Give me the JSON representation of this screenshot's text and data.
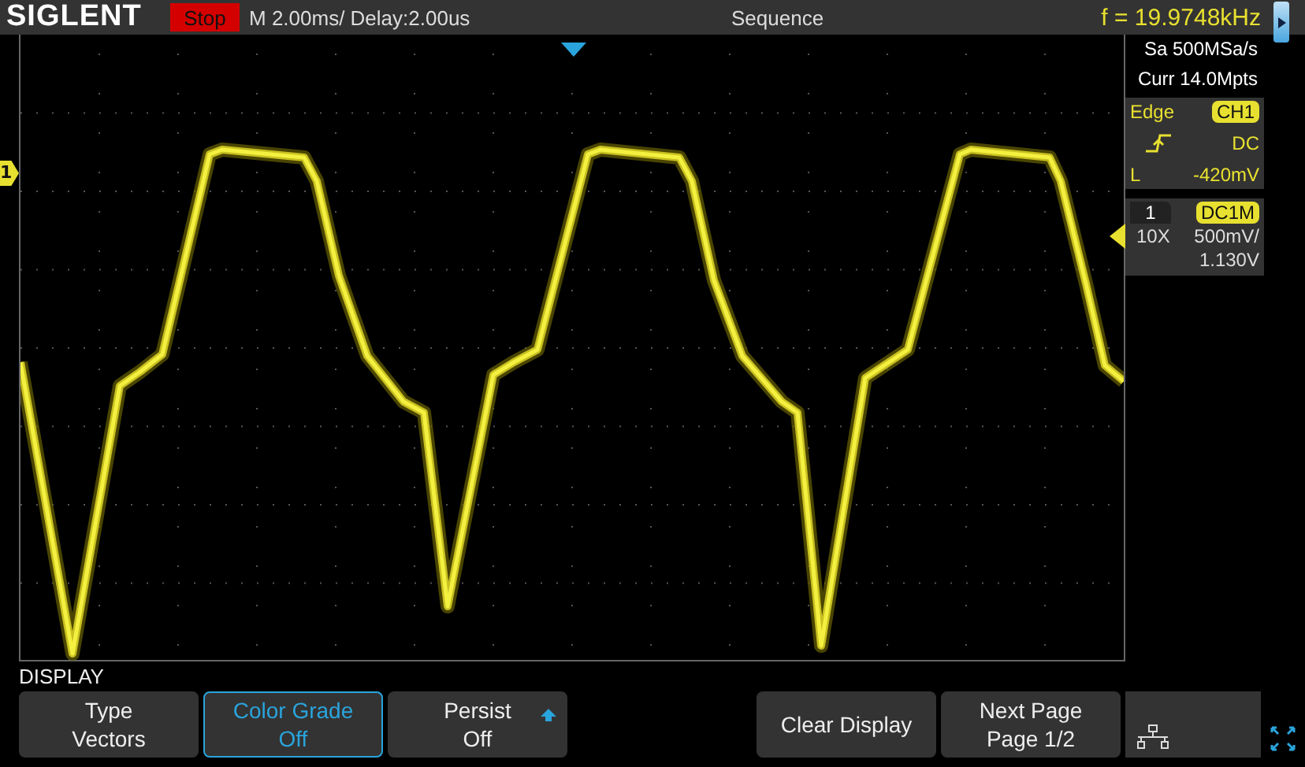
{
  "header": {
    "brand": "SIGLENT",
    "run_state": "Stop",
    "timebase": "M 2.00ms/ Delay:2.00us",
    "trigger_mode": "Sequence",
    "frequency": "f = 19.9748kHz"
  },
  "acquisition": {
    "sample_rate": "Sa 500MSa/s",
    "memory": "Curr 14.0Mpts"
  },
  "trigger": {
    "type": "Edge",
    "source": "CH1",
    "coupling": "DC",
    "threshold_label": "L",
    "threshold": "-420mV"
  },
  "channel": {
    "number": "1",
    "coupling": "DC1M",
    "probe": "10X",
    "scale": "500mV/",
    "offset": "1.130V"
  },
  "channel_marker": "1",
  "menu": {
    "title": "DISPLAY",
    "left_buttons": [
      {
        "kind": "two-line",
        "label": "Type",
        "value": "Vectors",
        "selected": false,
        "arrow": false
      },
      {
        "kind": "two-line",
        "label": "Color Grade",
        "value": "Off",
        "selected": true,
        "arrow": false
      },
      {
        "kind": "two-line",
        "label": "Persist",
        "value": "Off",
        "selected": false,
        "arrow": true
      }
    ],
    "right_buttons": [
      {
        "kind": "single",
        "label": "Clear Display",
        "selected": false
      },
      {
        "kind": "two-line",
        "label": "Next Page",
        "value": "Page 1/2",
        "selected": false,
        "arrow": false
      },
      {
        "kind": "network",
        "selected": false
      }
    ]
  }
}
